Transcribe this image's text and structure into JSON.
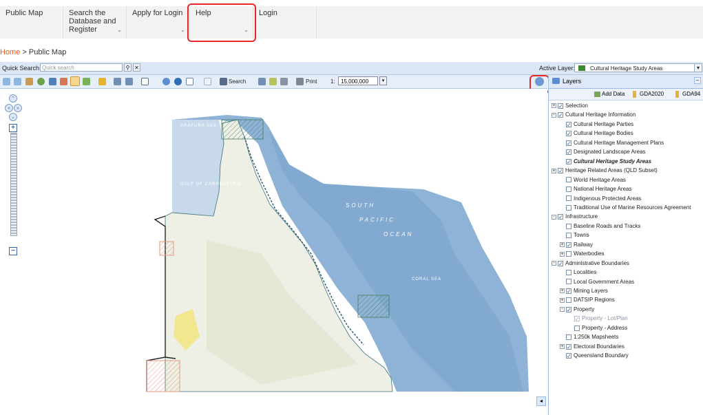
{
  "nav": {
    "items": [
      {
        "label": "Public Map"
      },
      {
        "label": "Search the Database and Register"
      },
      {
        "label": "Apply for Login"
      },
      {
        "label": "Help"
      },
      {
        "label": "Login"
      }
    ]
  },
  "breadcrumb": {
    "home": "Home",
    "separator": ">",
    "current": "Public Map"
  },
  "quick_search": {
    "label": "Quick Search:",
    "placeholder": "Quick search"
  },
  "active_layer": {
    "label": "Active Layer:",
    "value": "Cultural Heritage Study Areas"
  },
  "toolbar": {
    "search_label": "Search",
    "print_label": "Print",
    "scale_label": "1:",
    "scale_value": "15,000,000"
  },
  "map": {
    "labels": {
      "arafura": "ARAFURA SEA",
      "carpentaria": "GULF OF CARPENTARIA",
      "south": "SOUTH",
      "pacific": "PACIFIC",
      "ocean": "OCEAN",
      "coral": "CORAL SEA"
    }
  },
  "layers_panel": {
    "title": "Layers",
    "add_data": "Add Data",
    "gda2020": "GDA2020",
    "gda94": "GDA94",
    "tree": [
      {
        "label": "Selection",
        "expander": "+",
        "checked": true
      },
      {
        "label": "Cultural Heritage Information",
        "expander": "-",
        "checked": true
      },
      {
        "label": "Cultural Heritage Parties",
        "indent": 1,
        "checked": true
      },
      {
        "label": "Cultural Heritage Bodies",
        "indent": 1,
        "checked": true
      },
      {
        "label": "Cultural Heritage Management Plans",
        "indent": 1,
        "checked": true
      },
      {
        "label": "Designated Landscape Areas",
        "indent": 1,
        "checked": true
      },
      {
        "label": "Cultural Heritage Study Areas",
        "indent": 1,
        "checked": true,
        "active": true
      },
      {
        "label": "Heritage Related Areas (QLD Subset)",
        "expander": "+",
        "checked": true
      },
      {
        "label": "World Heritage Areas",
        "indent": 1,
        "checked": false
      },
      {
        "label": "National Heritage Areas",
        "indent": 1,
        "checked": false
      },
      {
        "label": "Indigenous Protected Areas",
        "indent": 1,
        "checked": false
      },
      {
        "label": "Traditional Use of Marine Resources Agreement",
        "indent": 1,
        "checked": false
      },
      {
        "label": "Infrastructure",
        "expander": "-",
        "checked": true
      },
      {
        "label": "Baseline Roads and Tracks",
        "indent": 1,
        "checked": false
      },
      {
        "label": "Towns",
        "indent": 1,
        "checked": false
      },
      {
        "label": "Railway",
        "indent": 1,
        "expander": "+",
        "checked": true
      },
      {
        "label": "Waterbodies",
        "indent": 1,
        "expander": "+",
        "checked": false
      },
      {
        "label": "Administrative Boundaries",
        "expander": "-",
        "checked": true
      },
      {
        "label": "Localities",
        "indent": 1,
        "checked": false
      },
      {
        "label": "Local Government Areas",
        "indent": 1,
        "checked": false
      },
      {
        "label": "Mining Layers",
        "indent": 1,
        "expander": "+",
        "checked": true
      },
      {
        "label": "DATSIP Regions",
        "indent": 1,
        "expander": "+",
        "checked": false
      },
      {
        "label": "Property",
        "indent": 1,
        "expander": "-",
        "checked": true
      },
      {
        "label": "Property - Lot/Plan",
        "indent": 2,
        "checked": true,
        "disabled": true
      },
      {
        "label": "Property - Address",
        "indent": 2,
        "checked": false
      },
      {
        "label": "1:250k Mapsheets",
        "indent": 1,
        "checked": false
      },
      {
        "label": "Electoral Boundaries",
        "indent": 1,
        "expander": "+",
        "checked": true
      },
      {
        "label": "Queensland Boundary",
        "indent": 1,
        "checked": true
      }
    ]
  },
  "colors": {
    "highlight": "#e8262a",
    "breadcrumb_home": "#e25c1d",
    "ocean": "#8eb3d6",
    "land": "#eef0e6",
    "active_layer_swatch": "#3a8b34"
  },
  "icons": [
    "search-icon",
    "clear-icon",
    "zoom-in-icon",
    "zoom-out-icon",
    "pan-icon",
    "info-icon",
    "globe-icon",
    "print-icon",
    "layers-icon",
    "add-data-icon",
    "collapse-panel-icon"
  ]
}
